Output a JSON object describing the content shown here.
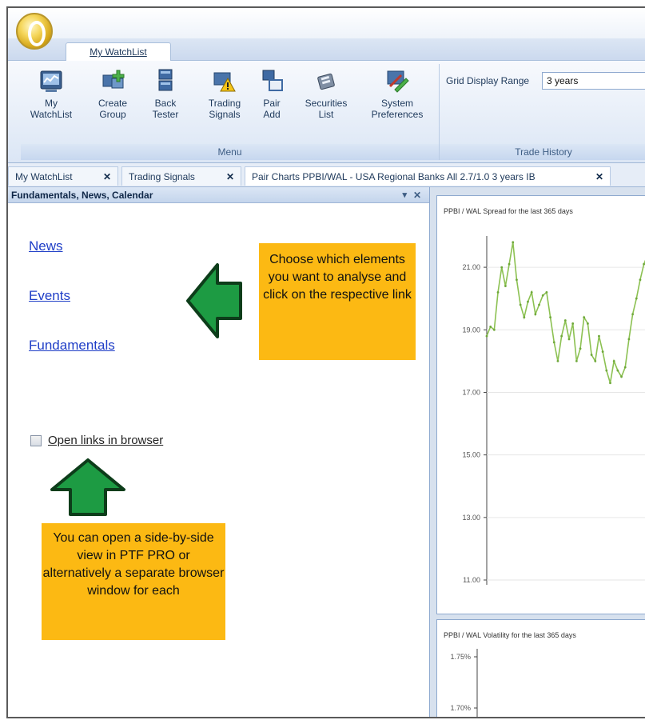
{
  "ribbon": {
    "tab_label": "My WatchList",
    "buttons": [
      {
        "label": "My\nWatchList",
        "icon": "watchlist-icon"
      },
      {
        "label": "Create\nGroup",
        "icon": "create-group-icon"
      },
      {
        "label": "Back\nTester",
        "icon": "back-tester-icon"
      },
      {
        "label": "Trading\nSignals",
        "icon": "trading-signals-icon"
      },
      {
        "label": "Pair\nAdd",
        "icon": "pair-add-icon"
      },
      {
        "label": "Securities\nList",
        "icon": "securities-list-icon"
      },
      {
        "label": "System\nPreferences",
        "icon": "system-preferences-icon"
      }
    ],
    "menu_caption": "Menu",
    "grid_range_label": "Grid Display Range",
    "grid_range_value": "3 years",
    "trade_history_caption": "Trade History"
  },
  "doc_tabs": [
    {
      "label": "My WatchList"
    },
    {
      "label": "Trading Signals"
    },
    {
      "label": "Pair Charts PPBI/WAL - USA Regional Banks All 2.7/1.0 3 years IB"
    }
  ],
  "left_panel": {
    "title": "Fundamentals, News, Calendar",
    "pin": "▾",
    "close": "✕",
    "links": {
      "news": "News",
      "events": "Events",
      "fundamentals": "Fundamentals"
    },
    "open_links_label": "Open links in browser",
    "open_links_checked": false,
    "note_1": "Choose which elements you want to analyse and click on the respective link",
    "note_2": "You can open a side-by-side view in PTF PRO or alternatively a separate browser window for each"
  },
  "charts": {
    "spread_title": "PPBI / WAL Spread  for the last 365 days",
    "volatility_title": "PPBI / WAL Volatility  for the last 365 days"
  },
  "chart_data": [
    {
      "type": "line",
      "title": "PPBI / WAL Spread  for the last 365 days",
      "y_ticks": [
        "21.00",
        "19.00",
        "17.00",
        "15.00",
        "13.00",
        "11.00"
      ],
      "ylim": [
        11,
        22
      ],
      "series": [
        {
          "color": "#8cc152",
          "values": [
            18.8,
            19.1,
            19.0,
            20.2,
            21.0,
            20.4,
            21.1,
            21.8,
            20.6,
            19.8,
            19.4,
            19.9,
            20.2,
            19.5,
            19.8,
            20.1,
            20.2,
            19.4,
            18.6,
            18.0,
            18.8,
            19.3,
            18.7,
            19.2,
            18.0,
            18.4,
            19.4,
            19.2,
            18.2,
            18.0,
            18.8,
            18.3,
            17.7,
            17.3,
            18.0,
            17.7,
            17.5,
            17.8,
            18.7,
            19.5,
            20.0,
            20.6,
            21.1,
            21.4,
            20.6
          ]
        }
      ]
    },
    {
      "type": "line",
      "title": "PPBI / WAL Volatility  for the last 365 days",
      "y_ticks": [
        "1.75%",
        "1.70%"
      ],
      "series": []
    }
  ]
}
